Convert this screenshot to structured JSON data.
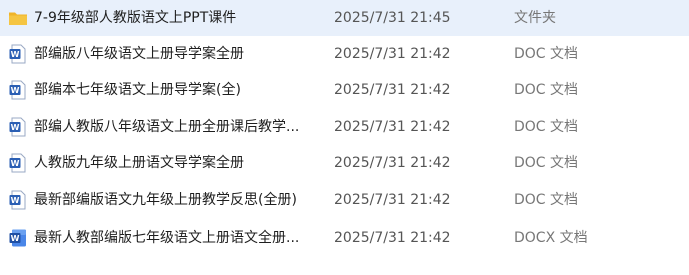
{
  "colors": {
    "folder": "#f5c542",
    "word_blue": "#2b5fb4",
    "name_text": "#1f1f1f",
    "meta_text": "#555555"
  },
  "files": [
    {
      "icon": "folder-icon",
      "name": "7-9年级部人教版语文上PPT课件",
      "modified": "2025/7/31 21:45",
      "type": "文件夹"
    },
    {
      "icon": "word-doc-icon",
      "name": "部编版八年级语文上册导学案全册",
      "modified": "2025/7/31 21:42",
      "type": "DOC 文档"
    },
    {
      "icon": "word-doc-icon",
      "name": "部编本七年级语文上册导学案(全)",
      "modified": "2025/7/31 21:42",
      "type": "DOC 文档"
    },
    {
      "icon": "word-doc-icon",
      "name": "部编人教版八年级语文上册全册课后教学...",
      "modified": "2025/7/31 21:42",
      "type": "DOC 文档"
    },
    {
      "icon": "word-doc-icon",
      "name": "人教版九年级上册语文导学案全册",
      "modified": "2025/7/31 21:42",
      "type": "DOC 文档"
    },
    {
      "icon": "word-doc-icon",
      "name": "最新部编版语文九年级上册教学反思(全册)",
      "modified": "2025/7/31 21:42",
      "type": "DOC 文档"
    },
    {
      "icon": "word-docx-icon",
      "name": "最新人教部编版七年级语文上册语文全册...",
      "modified": "2025/7/31 21:42",
      "type": "DOCX 文档"
    }
  ]
}
